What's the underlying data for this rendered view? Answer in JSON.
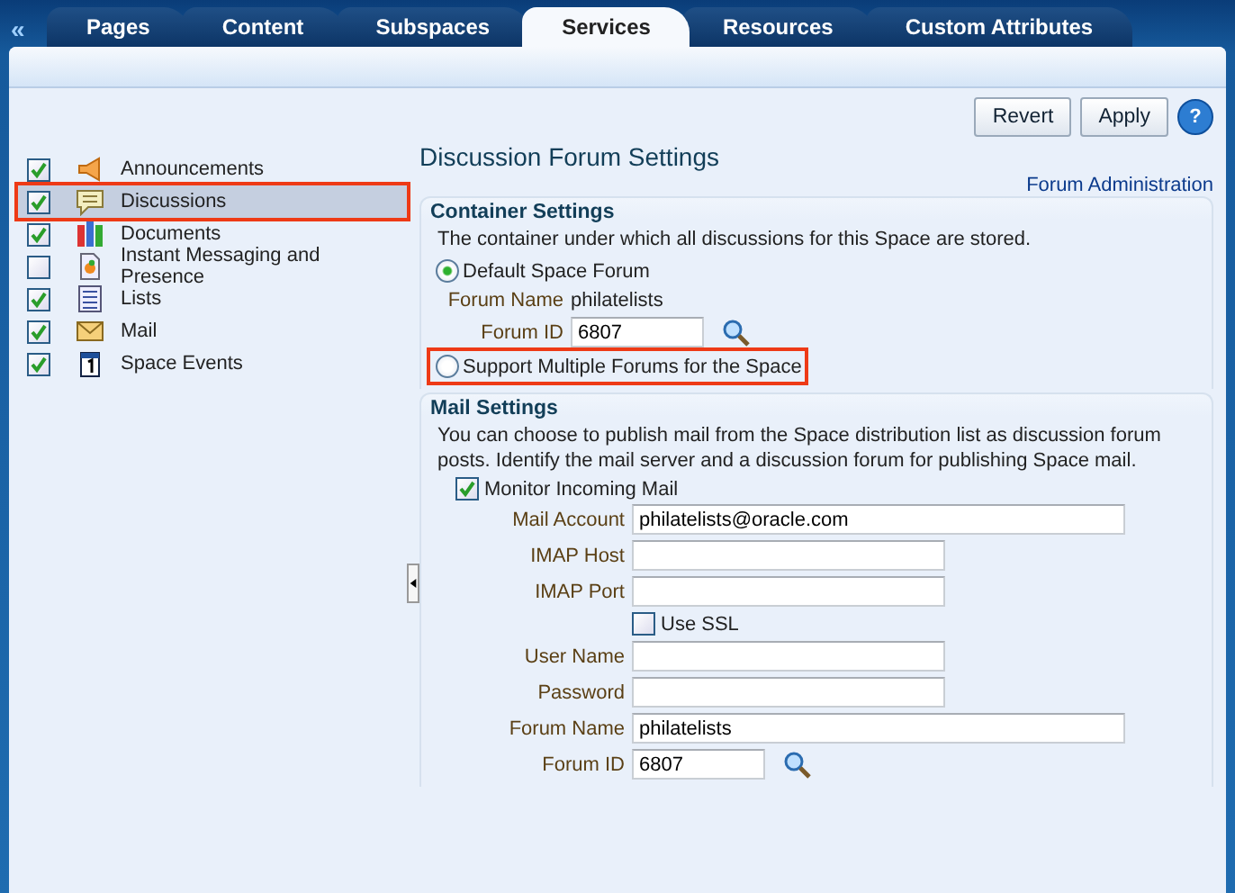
{
  "collapse": "«",
  "tabs": [
    {
      "label": "Pages",
      "selected": false
    },
    {
      "label": "Content",
      "selected": false
    },
    {
      "label": "Subspaces",
      "selected": false
    },
    {
      "label": "Services",
      "selected": true
    },
    {
      "label": "Resources",
      "selected": false
    },
    {
      "label": "Custom Attributes",
      "selected": false
    }
  ],
  "toolbar": {
    "buttons": [
      "Revert",
      "Apply"
    ],
    "help": "?"
  },
  "services": [
    {
      "label": "Announcements",
      "kind": "megaphone",
      "checked": true,
      "selected": false
    },
    {
      "label": "Discussions",
      "kind": "speech",
      "checked": true,
      "selected": true
    },
    {
      "label": "Documents",
      "kind": "books",
      "checked": true,
      "selected": false
    },
    {
      "label": "Instant Messaging and Presence",
      "kind": "presence",
      "checked": false,
      "selected": false
    },
    {
      "label": "Lists",
      "kind": "list",
      "checked": true,
      "selected": false
    },
    {
      "label": "Mail",
      "kind": "envelope",
      "checked": true,
      "selected": false
    },
    {
      "label": "Space Events",
      "kind": "calendar",
      "checked": true,
      "selected": false
    }
  ],
  "settings": {
    "title": "Discussion Forum Settings",
    "link": "Forum Administration",
    "container": {
      "heading": "Container Settings",
      "description": "The container under which all discussions for this Space are stored.",
      "options": [
        {
          "label": "Default Space Forum",
          "selected": true,
          "highlighted": false
        },
        {
          "label": "Support Multiple Forums for the Space",
          "selected": false,
          "highlighted": true
        }
      ],
      "forum_name_label": "Forum Name",
      "forum_name": "philatelists",
      "forum_id_label": "Forum ID",
      "forum_id": "6807"
    },
    "mail": {
      "heading": "Mail Settings",
      "description": "You can choose to publish mail from the Space distribution list as discussion forum posts. Identify the mail server and a discussion forum for publishing Space mail.",
      "monitor": {
        "label": "Monitor Incoming Mail",
        "checked": true
      },
      "fields": [
        {
          "kind": "wide",
          "label": "Mail Account",
          "value": "philatelists@oracle.com"
        },
        {
          "kind": "narrow",
          "label": "IMAP Host"
        },
        {
          "kind": "narrow",
          "label": "IMAP Port"
        },
        {
          "kind": "checkbox",
          "label": "Use SSL",
          "checked": false
        },
        {
          "kind": "narrow",
          "label": "User Name"
        },
        {
          "kind": "narrow",
          "label": "Password"
        },
        {
          "kind": "wide",
          "label": "Forum Name",
          "value": "philatelists"
        },
        {
          "kind": "lookup",
          "label": "Forum ID",
          "value": "6807"
        }
      ]
    }
  }
}
